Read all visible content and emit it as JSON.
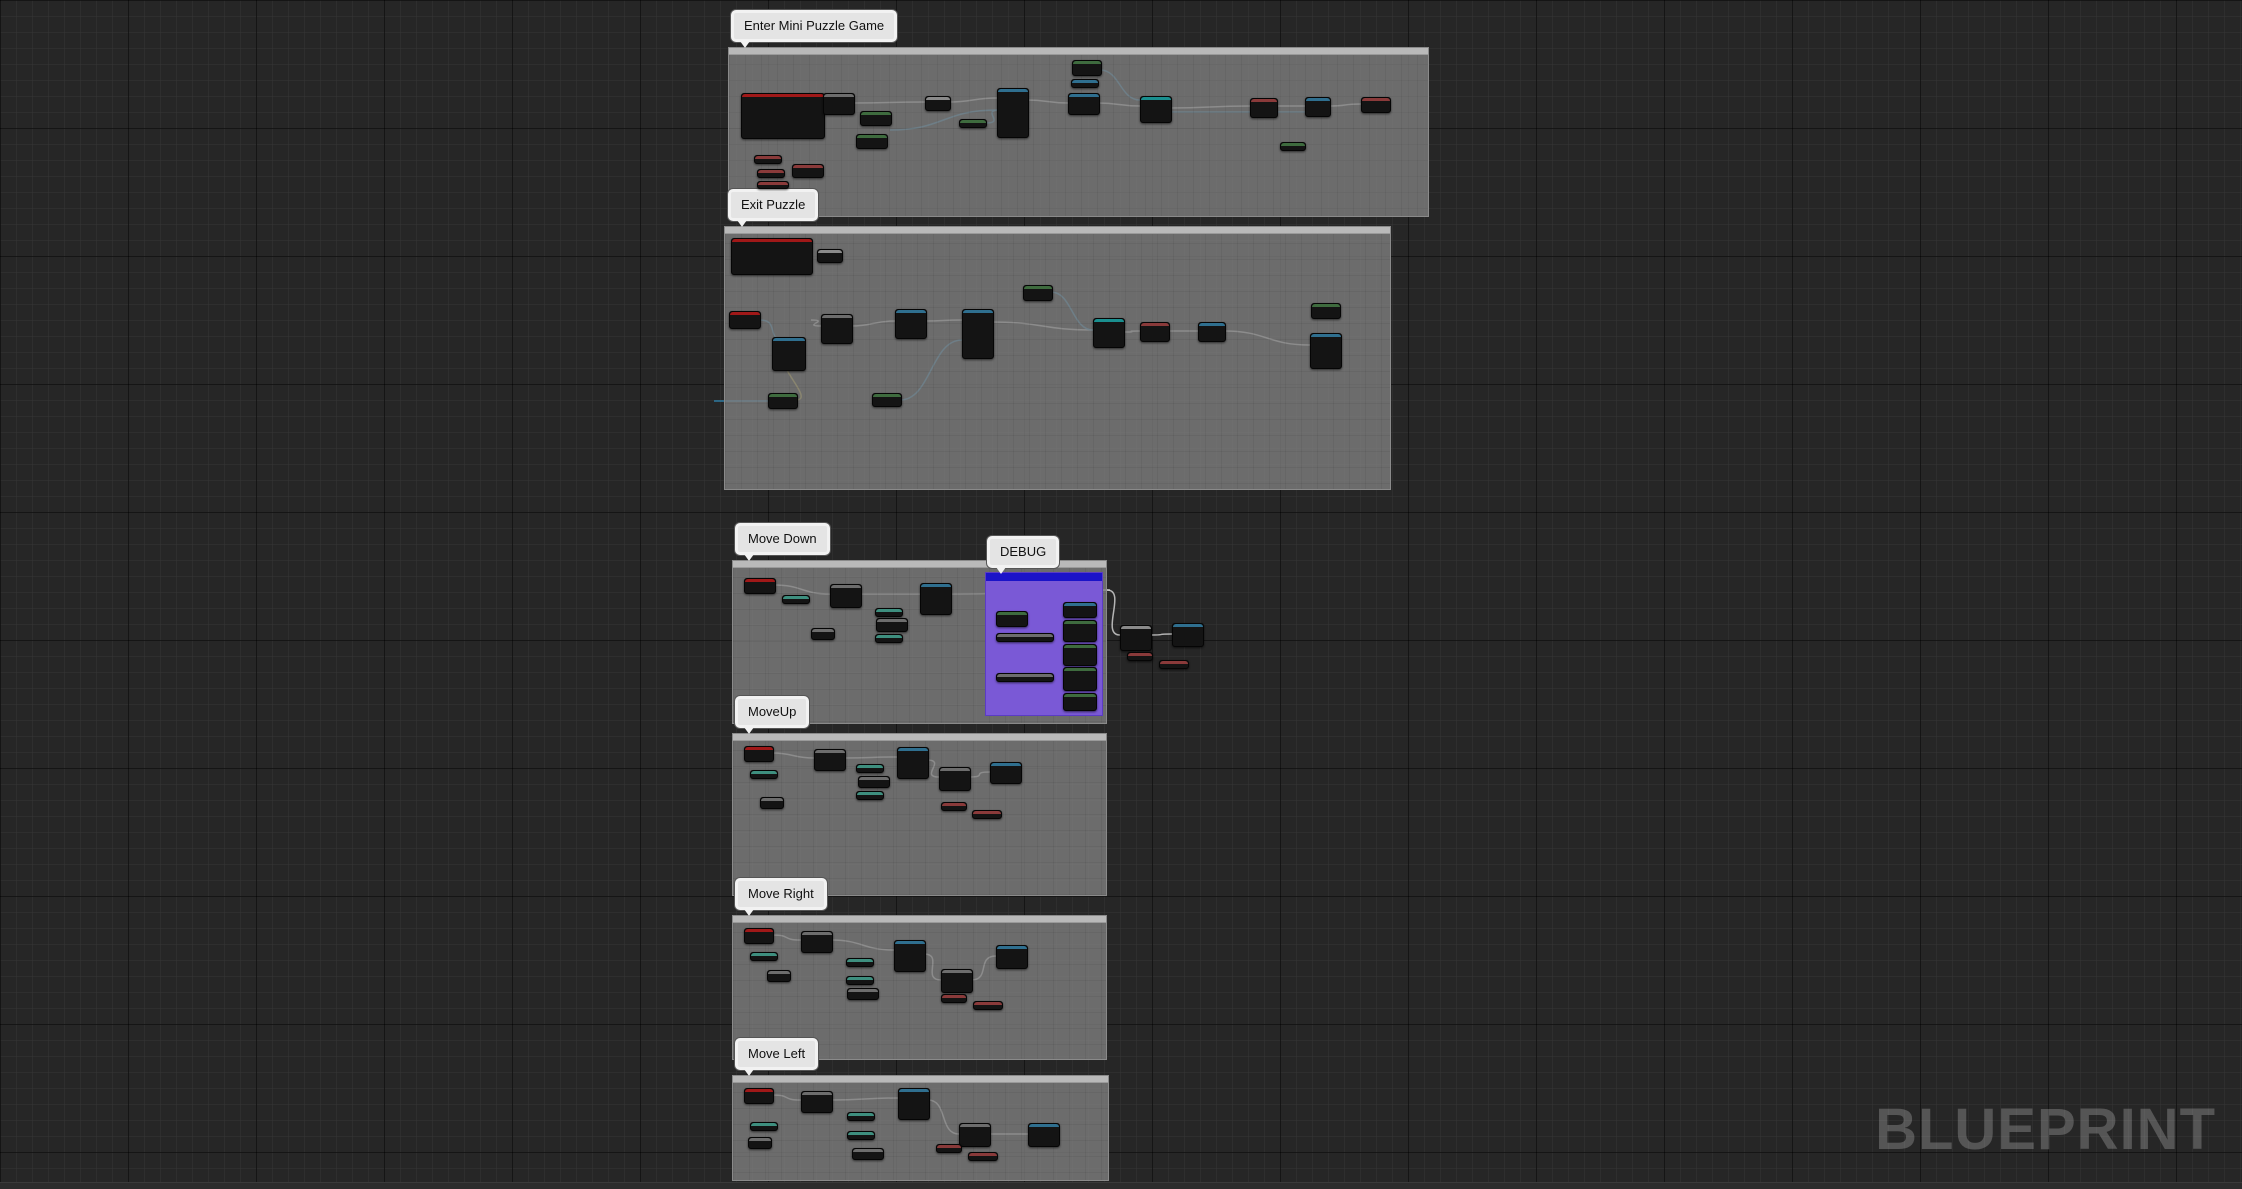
{
  "comments": [
    {
      "title": "Enter Mini Puzzle Game"
    },
    {
      "title": "Exit Puzzle"
    },
    {
      "title": "Move Down"
    },
    {
      "title": "DEBUG"
    },
    {
      "title": "MoveUp"
    },
    {
      "title": "Move Right"
    },
    {
      "title": "Move Left"
    }
  ],
  "watermark": "BLUEPRINT",
  "colors": {
    "event_node": "#a01818",
    "function_node": "#6d6d6d",
    "variable_node": "#3e6b3e",
    "exec_wire": "#d8d8d8",
    "object_wire": "#2f8fbf",
    "debug_comment": "#7a59d6"
  }
}
